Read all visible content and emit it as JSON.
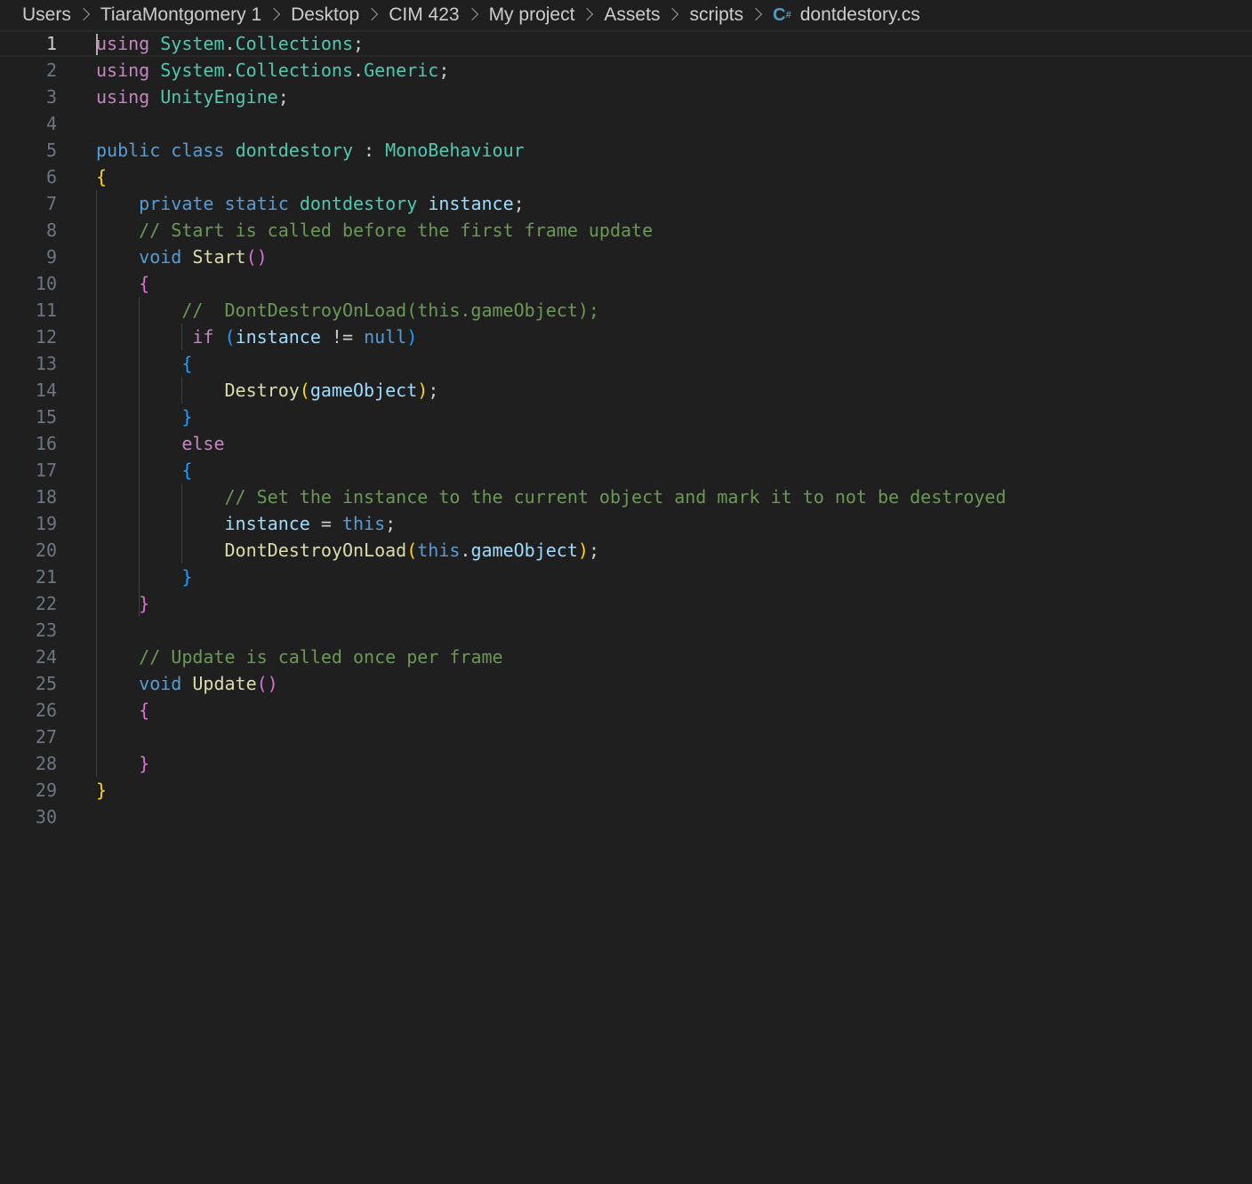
{
  "breadcrumb": {
    "items": [
      "Users",
      "TiaraMontgomery 1",
      "Desktop",
      "CIM 423",
      "My project",
      "Assets",
      "scripts"
    ],
    "file_icon": "C#",
    "file_name": "dontdestory.cs"
  },
  "editor": {
    "active_line": 1,
    "lines": [
      {
        "n": "1",
        "tokens": [
          [
            "using",
            "k"
          ],
          [
            " ",
            ""
          ],
          [
            "System",
            "t"
          ],
          [
            ".",
            "p"
          ],
          [
            "Collections",
            "t"
          ],
          [
            ";",
            "p"
          ]
        ]
      },
      {
        "n": "2",
        "tokens": [
          [
            "using",
            "k"
          ],
          [
            " ",
            ""
          ],
          [
            "System",
            "t"
          ],
          [
            ".",
            "p"
          ],
          [
            "Collections",
            "t"
          ],
          [
            ".",
            "p"
          ],
          [
            "Generic",
            "t"
          ],
          [
            ";",
            "p"
          ]
        ]
      },
      {
        "n": "3",
        "tokens": [
          [
            "using",
            "k"
          ],
          [
            " ",
            ""
          ],
          [
            "UnityEngine",
            "t"
          ],
          [
            ";",
            "p"
          ]
        ]
      },
      {
        "n": "4",
        "tokens": []
      },
      {
        "n": "5",
        "tokens": [
          [
            "public",
            "kw"
          ],
          [
            " ",
            ""
          ],
          [
            "class",
            "kw"
          ],
          [
            " ",
            ""
          ],
          [
            "dontdestory",
            "t"
          ],
          [
            " : ",
            "p"
          ],
          [
            "MonoBehaviour",
            "t"
          ]
        ]
      },
      {
        "n": "6",
        "tokens": [
          [
            "{",
            "b1"
          ]
        ]
      },
      {
        "n": "7",
        "tokens": [
          [
            "    ",
            ""
          ],
          [
            "private",
            "kw"
          ],
          [
            " ",
            ""
          ],
          [
            "static",
            "kw"
          ],
          [
            " ",
            ""
          ],
          [
            "dontdestory",
            "t"
          ],
          [
            " ",
            ""
          ],
          [
            "instance",
            "v"
          ],
          [
            ";",
            "p"
          ]
        ]
      },
      {
        "n": "8",
        "tokens": [
          [
            "    ",
            ""
          ],
          [
            "// Start is called before the first frame update",
            "c"
          ]
        ]
      },
      {
        "n": "9",
        "tokens": [
          [
            "    ",
            ""
          ],
          [
            "void",
            "kw"
          ],
          [
            " ",
            ""
          ],
          [
            "Start",
            "f"
          ],
          [
            "()",
            "b2"
          ]
        ]
      },
      {
        "n": "10",
        "tokens": [
          [
            "    ",
            ""
          ],
          [
            "{",
            "b2"
          ]
        ]
      },
      {
        "n": "11",
        "tokens": [
          [
            "        ",
            ""
          ],
          [
            "//  DontDestroyOnLoad(this.gameObject);",
            "c"
          ]
        ]
      },
      {
        "n": "12",
        "tokens": [
          [
            "         ",
            ""
          ],
          [
            "if",
            "k"
          ],
          [
            " ",
            ""
          ],
          [
            "(",
            "b3"
          ],
          [
            "instance",
            "v"
          ],
          [
            " != ",
            "p"
          ],
          [
            "null",
            "kw"
          ],
          [
            ")",
            "b3"
          ]
        ]
      },
      {
        "n": "13",
        "tokens": [
          [
            "        ",
            ""
          ],
          [
            "{",
            "b3"
          ]
        ]
      },
      {
        "n": "14",
        "tokens": [
          [
            "            ",
            ""
          ],
          [
            "Destroy",
            "f"
          ],
          [
            "(",
            "b1"
          ],
          [
            "gameObject",
            "v"
          ],
          [
            ")",
            "b1"
          ],
          [
            ";",
            "p"
          ]
        ]
      },
      {
        "n": "15",
        "tokens": [
          [
            "        ",
            ""
          ],
          [
            "}",
            "b3"
          ]
        ]
      },
      {
        "n": "16",
        "tokens": [
          [
            "        ",
            ""
          ],
          [
            "else",
            "k"
          ]
        ]
      },
      {
        "n": "17",
        "tokens": [
          [
            "        ",
            ""
          ],
          [
            "{",
            "b3"
          ]
        ]
      },
      {
        "n": "18",
        "tokens": [
          [
            "            ",
            ""
          ],
          [
            "// Set the instance to the current object and mark it to not be destroyed",
            "c"
          ]
        ]
      },
      {
        "n": "19",
        "tokens": [
          [
            "            ",
            ""
          ],
          [
            "instance",
            "v"
          ],
          [
            " = ",
            "p"
          ],
          [
            "this",
            "kw"
          ],
          [
            ";",
            "p"
          ]
        ]
      },
      {
        "n": "20",
        "tokens": [
          [
            "            ",
            ""
          ],
          [
            "DontDestroyOnLoad",
            "f"
          ],
          [
            "(",
            "b1"
          ],
          [
            "this",
            "kw"
          ],
          [
            ".",
            "p"
          ],
          [
            "gameObject",
            "v"
          ],
          [
            ")",
            "b1"
          ],
          [
            ";",
            "p"
          ]
        ]
      },
      {
        "n": "21",
        "tokens": [
          [
            "        ",
            ""
          ],
          [
            "}",
            "b3"
          ]
        ]
      },
      {
        "n": "22",
        "tokens": [
          [
            "    ",
            ""
          ],
          [
            "}",
            "b2"
          ]
        ]
      },
      {
        "n": "23",
        "tokens": []
      },
      {
        "n": "24",
        "tokens": [
          [
            "    ",
            ""
          ],
          [
            "// Update is called once per frame",
            "c"
          ]
        ]
      },
      {
        "n": "25",
        "tokens": [
          [
            "    ",
            ""
          ],
          [
            "void",
            "kw"
          ],
          [
            " ",
            ""
          ],
          [
            "Update",
            "f"
          ],
          [
            "()",
            "b2"
          ]
        ]
      },
      {
        "n": "26",
        "tokens": [
          [
            "    ",
            ""
          ],
          [
            "{",
            "b2"
          ]
        ]
      },
      {
        "n": "27",
        "tokens": []
      },
      {
        "n": "28",
        "tokens": [
          [
            "    ",
            ""
          ],
          [
            "}",
            "b2"
          ]
        ]
      },
      {
        "n": "29",
        "tokens": [
          [
            "}",
            "b1"
          ]
        ]
      },
      {
        "n": "30",
        "tokens": []
      }
    ]
  },
  "colors": {
    "background": "#1f1f1f",
    "keyword_control": "#c586c0",
    "keyword_storage": "#569cd6",
    "type": "#4ec9b0",
    "variable": "#9cdcfe",
    "function": "#dcdcaa",
    "comment": "#6a9955",
    "bracket_1": "#ffd700",
    "bracket_2": "#da70d6",
    "bracket_3": "#179fff",
    "csharp_icon": "#519aba"
  }
}
